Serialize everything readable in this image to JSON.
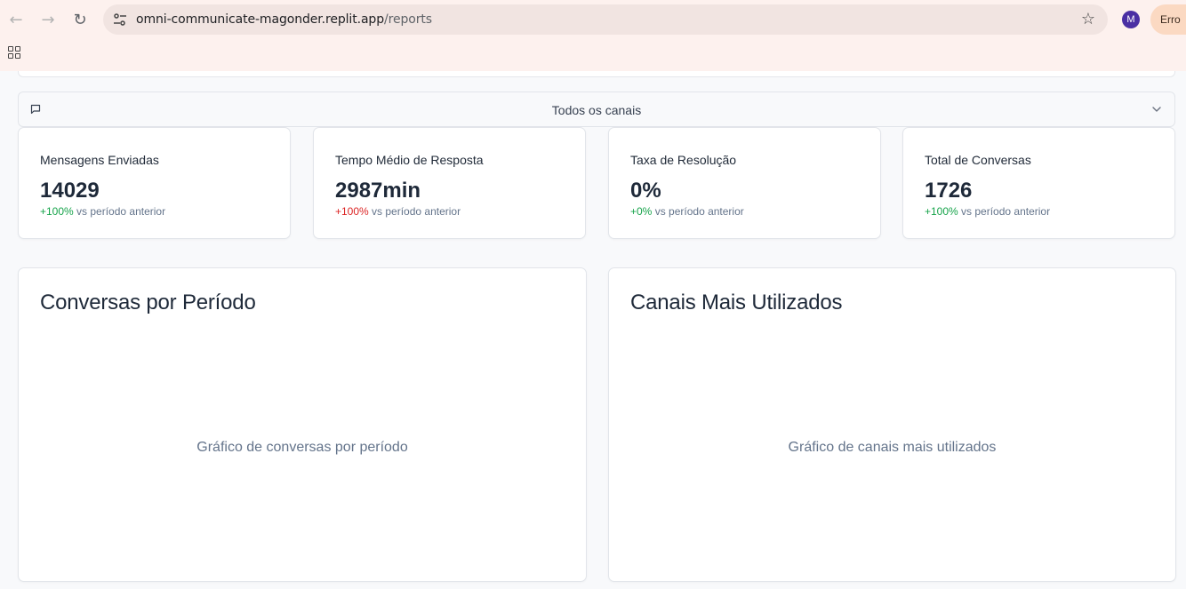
{
  "browser": {
    "url_host": "omni-communicate-magonder.replit.app",
    "url_path": "/reports",
    "avatar_letter": "M",
    "error_label": "Erro"
  },
  "filter": {
    "channel_label": "Todos os canais"
  },
  "stats": [
    {
      "title": "Mensagens Enviadas",
      "value": "14029",
      "change": "+100%",
      "change_suffix": "vs período anterior",
      "trend": "positive"
    },
    {
      "title": "Tempo Médio de Resposta",
      "value": "2987min",
      "change": "+100%",
      "change_suffix": "vs período anterior",
      "trend": "negative"
    },
    {
      "title": "Taxa de Resolução",
      "value": "0%",
      "change": "+0%",
      "change_suffix": "vs período anterior",
      "trend": "positive"
    },
    {
      "title": "Total de Conversas",
      "value": "1726",
      "change": "+100%",
      "change_suffix": "vs período anterior",
      "trend": "positive"
    }
  ],
  "charts": [
    {
      "title": "Conversas por Período",
      "placeholder": "Gráfico de conversas por período"
    },
    {
      "title": "Canais Mais Utilizados",
      "placeholder": "Gráfico de canais mais utilizados"
    }
  ],
  "icons": {
    "back": "arrow-left-icon",
    "forward": "arrow-right-icon",
    "reload": "reload-icon",
    "site_info": "tune-icon",
    "bookmark": "star-icon",
    "apps": "apps-grid-icon",
    "channel": "message-square-icon",
    "dropdown": "chevron-down-icon"
  },
  "colors": {
    "positive": "#16a34a",
    "negative": "#dc2626",
    "avatar": "#4a2fa3"
  }
}
